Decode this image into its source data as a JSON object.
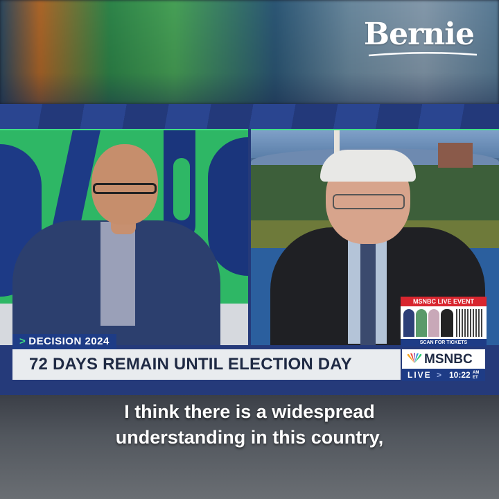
{
  "branding": {
    "logo_text": "Bernie"
  },
  "broadcast": {
    "section_label": "DECISION 2024",
    "headline": "72 DAYS REMAIN UNTIL ELECTION DAY",
    "network": "MSNBC",
    "live_label": "LIVE",
    "live_chevron": ">",
    "time": "10:22",
    "time_zone_top": "AM",
    "time_zone_bottom": "ET",
    "event_ad": {
      "header": "MSNBC LIVE EVENT",
      "footer": "SCAN FOR TICKETS"
    }
  },
  "caption": {
    "line1": "I think there is a widespread",
    "line2": "understanding in this country,"
  },
  "colors": {
    "accent_green": "#3fe085",
    "navy": "#1e3c86",
    "event_red": "#d8262f"
  },
  "icons": [
    "peacock-logo-icon",
    "qr-code-icon",
    "chevron-right-icon"
  ]
}
